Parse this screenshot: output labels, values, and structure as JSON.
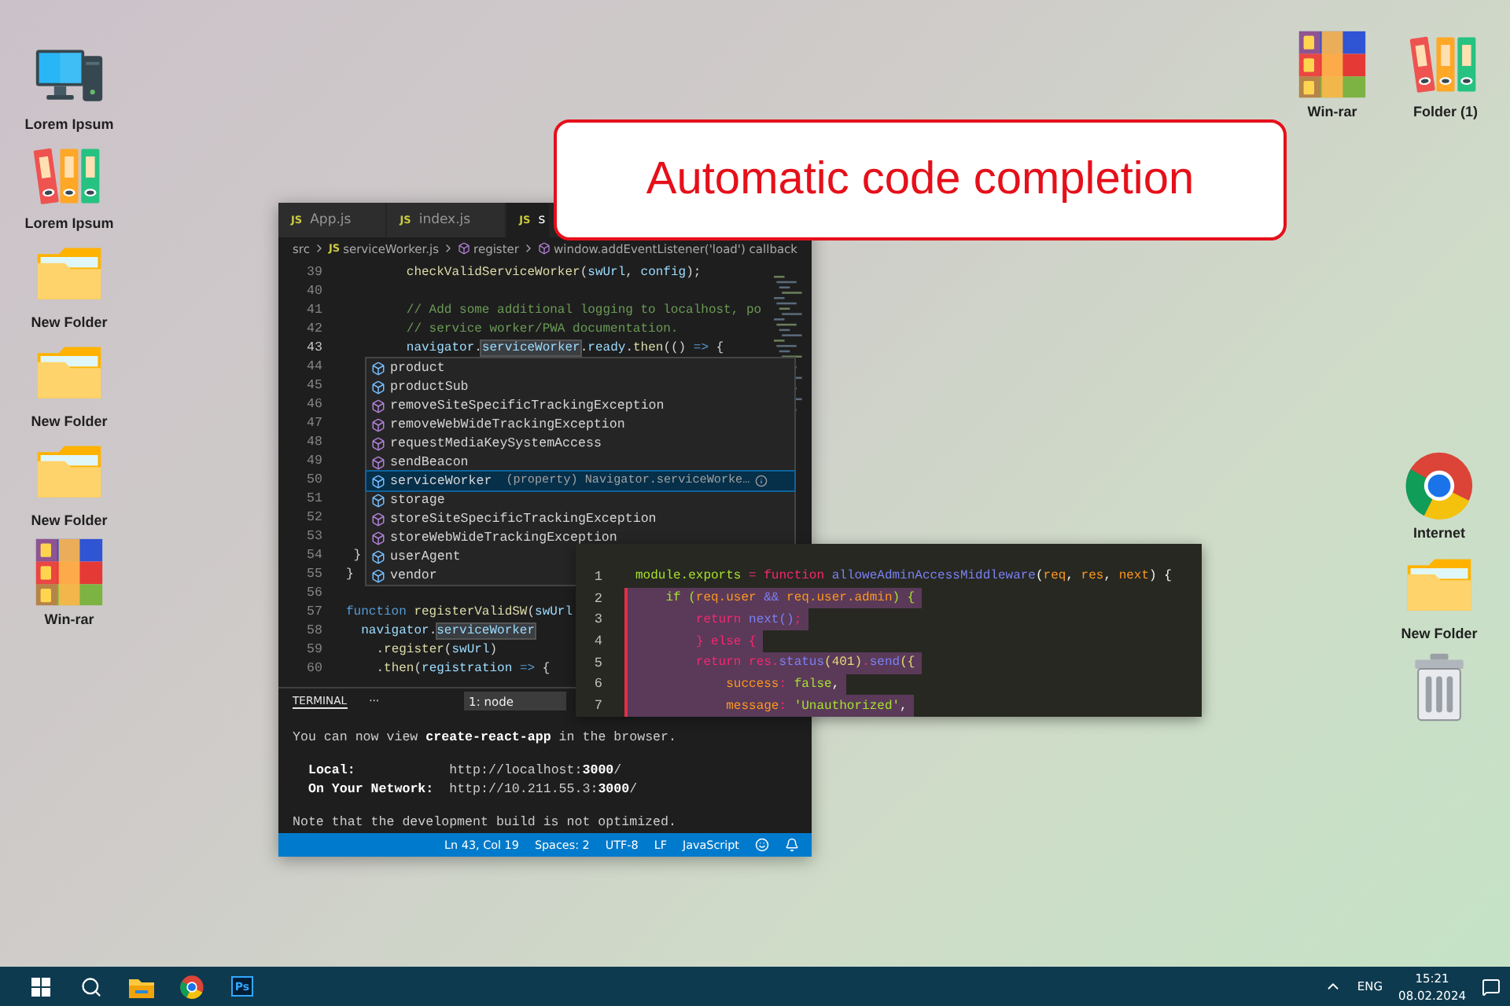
{
  "desktop": {
    "left_icons": [
      {
        "label": "Lorem Ipsum",
        "kind": "computer"
      },
      {
        "label": "Lorem Ipsum",
        "kind": "binders"
      },
      {
        "label": "New Folder",
        "kind": "folder"
      },
      {
        "label": "New Folder",
        "kind": "folder"
      },
      {
        "label": "New Folder",
        "kind": "folder"
      },
      {
        "label": "Win-rar",
        "kind": "archive"
      }
    ],
    "top_right_icons": [
      {
        "label": "Win-rar",
        "kind": "archive"
      },
      {
        "label": "Folder (1)",
        "kind": "binders"
      }
    ],
    "right_icons": [
      {
        "label": "Internet",
        "kind": "browser"
      },
      {
        "label": "New Folder",
        "kind": "folder"
      },
      {
        "kind": "trash"
      }
    ]
  },
  "callout": {
    "text": "Automatic code completion"
  },
  "editor": {
    "tabs": [
      {
        "badge": "JS",
        "label": "App.js",
        "selected": false
      },
      {
        "badge": "JS",
        "label": "index.js",
        "selected": false
      },
      {
        "badge": "JS",
        "label": "s",
        "selected": true
      }
    ],
    "breadcrumb": [
      {
        "kind": "folder",
        "text": "src"
      },
      {
        "kind": "file",
        "badge": "JS",
        "text": "serviceWorker.js"
      },
      {
        "kind": "symbol",
        "text": "register"
      },
      {
        "kind": "symbol",
        "text": "window.addEventListener('load') callback"
      }
    ],
    "lines": [
      {
        "number": "39",
        "current": false,
        "tokens": [
          {
            "text": "        checkValidServiceWorker",
            "kind": "fn"
          },
          {
            "text": "(",
            "kind": "plain"
          },
          {
            "text": "swUrl",
            "kind": "var"
          },
          {
            "text": ", ",
            "kind": "plain"
          },
          {
            "text": "config",
            "kind": "var"
          },
          {
            "text": ");",
            "kind": "plain"
          }
        ]
      },
      {
        "number": "40",
        "current": false
      },
      {
        "number": "41",
        "current": false,
        "tokens": [
          {
            "text": "        // Add some additional logging to localhost, po",
            "kind": "comment"
          }
        ]
      },
      {
        "number": "42",
        "current": false,
        "tokens": [
          {
            "text": "        // service worker/PWA documentation.",
            "kind": "comment"
          }
        ]
      },
      {
        "number": "43",
        "current": true,
        "tokens": [
          {
            "text": "        navigator",
            "kind": "var"
          },
          {
            "text": ".",
            "kind": "plain"
          },
          {
            "text": "serviceWorker",
            "kind": "match"
          },
          {
            "text": ".",
            "kind": "plain"
          },
          {
            "text": "ready",
            "kind": "var"
          },
          {
            "text": ".",
            "kind": "plain"
          },
          {
            "text": "then",
            "kind": "fn"
          },
          {
            "text": "(() ",
            "kind": "plain"
          },
          {
            "text": "=>",
            "kind": "kw"
          },
          {
            "text": " {",
            "kind": "plain"
          }
        ]
      },
      {
        "number": "44",
        "current": false
      },
      {
        "number": "45",
        "current": false
      },
      {
        "number": "46",
        "current": false
      },
      {
        "number": "47",
        "current": false
      },
      {
        "number": "48",
        "current": false
      },
      {
        "number": "49",
        "current": false
      },
      {
        "number": "50",
        "current": false
      },
      {
        "number": "51",
        "current": false
      },
      {
        "number": "52",
        "current": false
      },
      {
        "number": "53",
        "current": false
      },
      {
        "number": "54",
        "current": false,
        "tokens": [
          {
            "text": " }",
            "kind": "plain"
          }
        ]
      },
      {
        "number": "55",
        "current": false,
        "tokens": [
          {
            "text": "}",
            "kind": "plain"
          }
        ]
      },
      {
        "number": "56",
        "current": false
      },
      {
        "number": "57",
        "current": false,
        "tokens": [
          {
            "text": "function",
            "kind": "kw"
          },
          {
            "text": " registerValidSW",
            "kind": "fn"
          },
          {
            "text": "(",
            "kind": "plain"
          },
          {
            "text": "swUrl",
            "kind": "var"
          }
        ]
      },
      {
        "number": "58",
        "current": false,
        "tokens": [
          {
            "text": "  navigator",
            "kind": "var"
          },
          {
            "text": ".",
            "kind": "plain"
          },
          {
            "text": "serviceWorker",
            "kind": "match"
          }
        ]
      },
      {
        "number": "59",
        "current": false,
        "tokens": [
          {
            "text": "    .",
            "kind": "plain"
          },
          {
            "text": "register",
            "kind": "fn"
          },
          {
            "text": "(",
            "kind": "plain"
          },
          {
            "text": "swUrl",
            "kind": "var"
          },
          {
            "text": ")",
            "kind": "plain"
          }
        ]
      },
      {
        "number": "60",
        "current": false,
        "tokens": [
          {
            "text": "    .",
            "kind": "plain"
          },
          {
            "text": "then",
            "kind": "fn"
          },
          {
            "text": "(",
            "kind": "plain"
          },
          {
            "text": "registration ",
            "kind": "var"
          },
          {
            "text": "=>",
            "kind": "kw"
          },
          {
            "text": " {",
            "kind": "plain"
          }
        ]
      }
    ],
    "suggestions": [
      {
        "label": "product",
        "kind": "property",
        "selected": false
      },
      {
        "label": "productSub",
        "kind": "property",
        "selected": false
      },
      {
        "label": "removeSiteSpecificTrackingException",
        "kind": "method",
        "selected": false
      },
      {
        "label": "removeWebWideTrackingException",
        "kind": "method",
        "selected": false
      },
      {
        "label": "requestMediaKeySystemAccess",
        "kind": "method",
        "selected": false
      },
      {
        "label": "sendBeacon",
        "kind": "method",
        "selected": false
      },
      {
        "label": "serviceWorker",
        "kind": "property",
        "selected": true,
        "detail": "(property) Navigator.serviceWorke…"
      },
      {
        "label": "storage",
        "kind": "property",
        "selected": false
      },
      {
        "label": "storeSiteSpecificTrackingException",
        "kind": "method",
        "selected": false
      },
      {
        "label": "storeWebWideTrackingException",
        "kind": "method",
        "selected": false
      },
      {
        "label": "userAgent",
        "kind": "property",
        "selected": false
      },
      {
        "label": "vendor",
        "kind": "property",
        "selected": false
      }
    ],
    "terminal": {
      "title": "TERMINAL",
      "more": "···",
      "dropdown": "1: node",
      "blocks": [
        [
          "You can now view **create-react-app** in the browser."
        ],
        [
          "  **Local:**            http://localhost:**3000**/",
          "  **On Your Network:**  http://10.211.55.3:**3000**/"
        ],
        [
          "Note that the development build is not optimized."
        ]
      ]
    },
    "status_bar": {
      "items": [
        "Ln 43, Col 19",
        "Spaces: 2",
        "UTF-8",
        "LF",
        "JavaScript"
      ]
    }
  },
  "snippet": {
    "lines": [
      {
        "number": "1",
        "selected": false,
        "tokens": [
          {
            "text": "module.exports",
            "kind": "name"
          },
          {
            "text": " = ",
            "kind": "op"
          },
          {
            "text": "function ",
            "kind": "op"
          },
          {
            "text": "alloweAdminAccessMiddleware",
            "kind": "fn"
          },
          {
            "text": "(",
            "kind": "plain"
          },
          {
            "text": "req",
            "kind": "param"
          },
          {
            "text": ", ",
            "kind": "plain"
          },
          {
            "text": "res",
            "kind": "param"
          },
          {
            "text": ", ",
            "kind": "plain"
          },
          {
            "text": "next",
            "kind": "param"
          },
          {
            "text": ") {",
            "kind": "plain"
          }
        ]
      },
      {
        "number": "2",
        "selected": true,
        "tokens": [
          {
            "text": "    if (",
            "kind": "name"
          },
          {
            "text": "req.user ",
            "kind": "param"
          },
          {
            "text": "&&",
            "kind": "fn"
          },
          {
            "text": " req.user.admin",
            "kind": "param"
          },
          {
            "text": ") {",
            "kind": "name"
          }
        ]
      },
      {
        "number": "3",
        "selected": true,
        "tokens": [
          {
            "text": "        return ",
            "kind": "op"
          },
          {
            "text": "next()",
            "kind": "fn"
          },
          {
            "text": ";",
            "kind": "op"
          }
        ]
      },
      {
        "number": "4",
        "selected": true,
        "tokens": [
          {
            "text": "        } else {",
            "kind": "op"
          }
        ]
      },
      {
        "number": "5",
        "selected": true,
        "tokens": [
          {
            "text": "        return res.",
            "kind": "op"
          },
          {
            "text": "status",
            "kind": "fn"
          },
          {
            "text": "(401)",
            "kind": "num"
          },
          {
            "text": ".",
            "kind": "op"
          },
          {
            "text": "send",
            "kind": "fn"
          },
          {
            "text": "({",
            "kind": "num"
          }
        ]
      },
      {
        "number": "6",
        "selected": true,
        "tokens": [
          {
            "text": "            success",
            "kind": "param"
          },
          {
            "text": ": ",
            "kind": "op"
          },
          {
            "text": "false",
            "kind": "name"
          },
          {
            "text": ",",
            "kind": "plain"
          }
        ]
      },
      {
        "number": "7",
        "selected": true,
        "tokens": [
          {
            "text": "            message",
            "kind": "param"
          },
          {
            "text": ": ",
            "kind": "op"
          },
          {
            "text": "'Unauthorized'",
            "kind": "name"
          },
          {
            "text": ",",
            "kind": "plain"
          }
        ]
      }
    ]
  },
  "taskbar": {
    "apps": [
      {
        "kind": "start"
      },
      {
        "kind": "search"
      },
      {
        "kind": "explorer"
      },
      {
        "kind": "browser"
      },
      {
        "kind": "photoshop",
        "text": "Ps"
      }
    ],
    "tray": {
      "language": "ENG",
      "time": "15:21",
      "date": "08.02.2024"
    }
  }
}
